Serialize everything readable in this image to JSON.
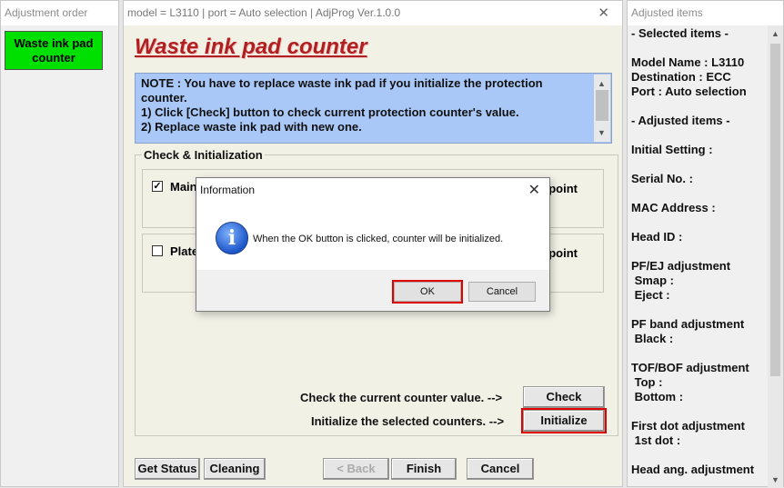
{
  "left_window": {
    "title": "Adjustment order",
    "waste_ink_button": "Waste ink pad counter"
  },
  "main_window": {
    "title": "model = L3110 | port = Auto selection | AdjProg Ver.1.0.0",
    "heading": "Waste ink pad counter",
    "note_lines": [
      "NOTE : You have to replace waste ink pad if you initialize the protection counter.",
      "1) Click [Check] button to check current protection counter's value.",
      "2) Replace waste ink pad with new one."
    ],
    "group_title": "Check & Initialization",
    "rows": [
      {
        "label": "Main",
        "checked": true,
        "suffix": "point"
      },
      {
        "label": "Plate",
        "checked": false,
        "suffix": "point"
      }
    ],
    "check_hint": "Check the current counter value. -->",
    "check_button": "Check",
    "init_hint": "Initialize the selected counters. -->",
    "init_button": "Initialize",
    "bottom_buttons": {
      "get_status": "Get Status",
      "cleaning": "Cleaning",
      "back": "< Back",
      "finish": "Finish",
      "cancel": "Cancel"
    }
  },
  "right_window": {
    "title": "Adjusted items",
    "lines": [
      "- Selected items -",
      "",
      "Model Name : L3110",
      "Destination : ECC",
      "Port : Auto selection",
      "",
      "- Adjusted items -",
      "",
      "Initial Setting :",
      "",
      "Serial No. :",
      "",
      "MAC Address :",
      "",
      "Head ID :",
      "",
      "PF/EJ adjustment",
      " Smap :",
      " Eject :",
      "",
      "PF band adjustment",
      " Black :",
      "",
      "TOF/BOF adjustment",
      " Top :",
      " Bottom :",
      "",
      "First dot adjustment",
      " 1st dot :",
      "",
      "Head ang. adjustment"
    ]
  },
  "dialog": {
    "title": "Information",
    "icon": "info-icon",
    "message": "When the OK button is clicked, counter will be initialized.",
    "ok": "OK",
    "cancel": "Cancel"
  },
  "colors": {
    "highlight": "#e00000",
    "note_bg": "#a9c8f8",
    "heading": "#b02020",
    "green_button": "#00e000"
  }
}
